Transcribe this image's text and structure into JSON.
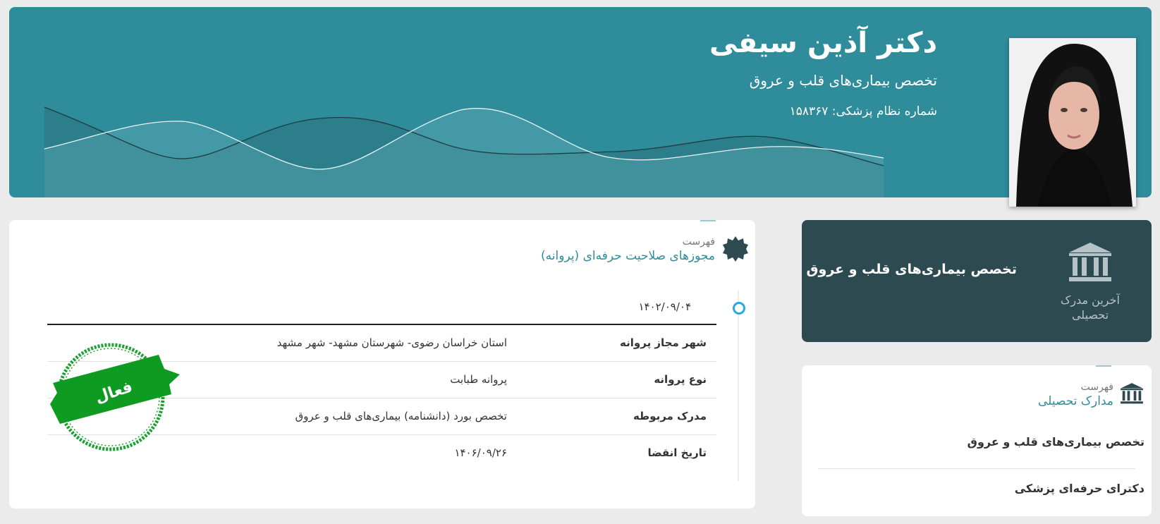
{
  "header": {
    "name": "دکتر آذین سیفی",
    "specialty": "تخصص بیماری‌های قلب و عروق",
    "license": "شماره نظام پزشکی: ۱۵۸۳۶۷"
  },
  "latest_degree": {
    "caption": "آخرین مدرک تحصیلی",
    "title": "تخصص بیماری‌های قلب و عروق"
  },
  "licenses_section": {
    "small": "فهرست",
    "title": "مجوزهای صلاحیت حرفه‌ای (پروانه)",
    "date": "۱۴۰۲/۰۹/۰۴",
    "rows": [
      {
        "label": "شهر مجاز پروانه",
        "value": "استان خراسان رضوی- شهرستان مشهد- شهر مشهد"
      },
      {
        "label": "نوع پروانه",
        "value": "پروانه طبابت"
      },
      {
        "label": "مدرک مربوطه",
        "value": "تخصص بورد (دانشنامه) بیماری‌های قلب و عروق"
      },
      {
        "label": "تاریخ انقضا",
        "value": "۱۴۰۶/۰۹/۲۶"
      }
    ],
    "stamp": "فعال"
  },
  "education_section": {
    "small": "فهرست",
    "title": "مدارک تحصیلی",
    "items": [
      "تخصص بیماری‌های قلب و عروق",
      "دکترای حرفه‌ای پزشکی"
    ]
  },
  "colors": {
    "header_bg": "#2e8c9b",
    "dark_card_bg": "#2d4a51",
    "accent": "#2e8c9b",
    "stamp_green": "#0f9a22",
    "timeline_dot": "#29a8e0"
  },
  "icons": {
    "license_section": "badge-seal-icon",
    "education_section": "institution-icon",
    "latest_degree": "institution-icon"
  }
}
